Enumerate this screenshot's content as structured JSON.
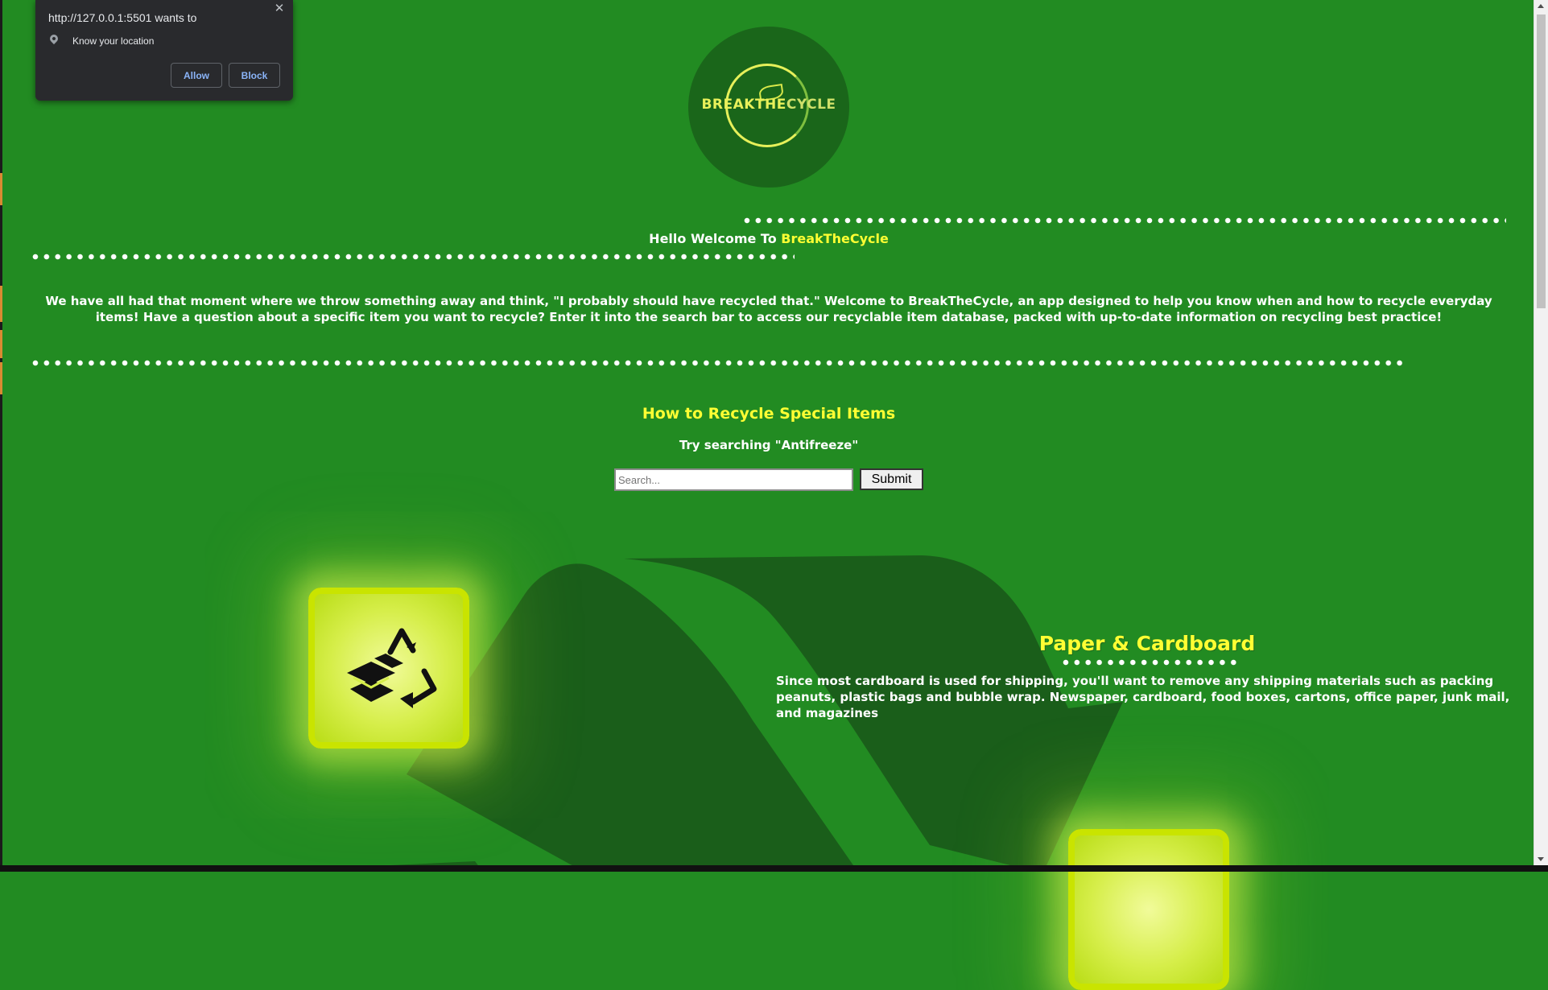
{
  "permission_prompt": {
    "origin": "http://127.0.0.1:5501 wants to",
    "permission": "Know your location",
    "allow_label": "Allow",
    "block_label": "Block",
    "close_glyph": "✕"
  },
  "logo": {
    "wordmark_part1": "BREAKTHE",
    "wordmark_part2": "CYCLE"
  },
  "welcome": {
    "prefix": "Hello Welcome To",
    "brand": "BreakTheCycle"
  },
  "intro": {
    "text": "We have all had that moment where we throw something away and think, \"I probably should have recycled that.\" Welcome to BreakTheCycle, an app designed to help you know when and how to recycle everyday items! Have a question about a specific item you want to recycle? Enter it into the search bar to access our recyclable item database, packed with up-to-date information on recycling best practice!"
  },
  "special_items": {
    "heading": "How to Recycle Special Items",
    "hint": "Try searching \"Antifreeze\"",
    "search_placeholder": "Search...",
    "submit_label": "Submit"
  },
  "categories": [
    {
      "title": "Paper & Cardboard",
      "description": "Since most cardboard is used for shipping, you'll want to remove any shipping materials such as packing peanuts, plastic bags and bubble wrap. Newspaper, cardboard, food boxes, cartons, office paper, junk mail, and magazines",
      "icon": "recycle-box-icon"
    }
  ],
  "colors": {
    "background": "#228B22",
    "accent_yellow": "#FFFF33",
    "card_glow": "#D6EE4A",
    "arrow_dark": "#1A5C1A"
  }
}
